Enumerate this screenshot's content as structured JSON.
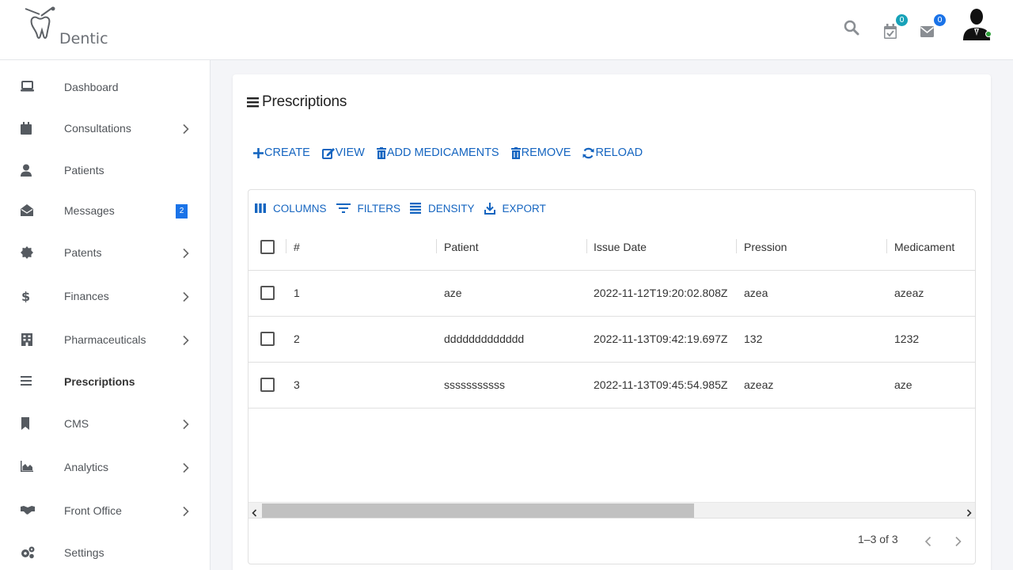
{
  "app": {
    "name": "Dentic"
  },
  "header": {
    "calendar_count": "0",
    "mail_count": "0",
    "colors": {
      "teal_badge": "#17a2b8",
      "blue_badge": "#1a73e8",
      "online": "#2e9f3a"
    }
  },
  "sidebar": {
    "items": [
      {
        "label": "Dashboard",
        "icon": "laptop-icon",
        "chevron": false
      },
      {
        "label": "Consultations",
        "icon": "calendar-icon",
        "chevron": true
      },
      {
        "label": "Patients",
        "icon": "user-icon",
        "chevron": false
      },
      {
        "label": "Messages",
        "icon": "envelope-open-icon",
        "chevron": false,
        "badge": "2"
      },
      {
        "label": "Patents",
        "icon": "certificate-icon",
        "chevron": true
      },
      {
        "label": "Finances",
        "icon": "dollar-icon",
        "chevron": true
      },
      {
        "label": "Pharmaceuticals",
        "icon": "building-icon",
        "chevron": true
      },
      {
        "label": "Prescriptions",
        "icon": "list-icon",
        "chevron": false,
        "active": true
      },
      {
        "label": "CMS",
        "icon": "bookmark-icon",
        "chevron": true
      },
      {
        "label": "Analytics",
        "icon": "chart-area-icon",
        "chevron": true
      },
      {
        "label": "Front Office",
        "icon": "handshake-icon",
        "chevron": true
      },
      {
        "label": "Settings",
        "icon": "cogs-icon",
        "chevron": false
      }
    ]
  },
  "page": {
    "title": "Prescriptions",
    "actions": {
      "create": "CREATE",
      "view": "VIEW",
      "add_medicaments": "ADD MEDICAMENTS",
      "remove": "REMOVE",
      "reload": "RELOAD"
    },
    "accent_color": "#1565c0"
  },
  "grid": {
    "toolbar": {
      "columns": "COLUMNS",
      "filters": "FILTERS",
      "density": "DENSITY",
      "export": "EXPORT"
    },
    "columns": [
      "#",
      "Patient",
      "Issue Date",
      "Pression",
      "Medicament"
    ],
    "rows": [
      {
        "id": "1",
        "patient": "aze",
        "issue_date": "2022-11-12T19:20:02.808Z",
        "pression": "azea",
        "medicament": "azeaz"
      },
      {
        "id": "2",
        "patient": "ddddddddddddd",
        "issue_date": "2022-11-13T09:42:19.697Z",
        "pression": "132",
        "medicament": "1232"
      },
      {
        "id": "3",
        "patient": "sssssssssss",
        "issue_date": "2022-11-13T09:45:54.985Z",
        "pression": "azeaz",
        "medicament": "aze"
      }
    ],
    "pagination": {
      "range": "1–3 of 3"
    }
  }
}
